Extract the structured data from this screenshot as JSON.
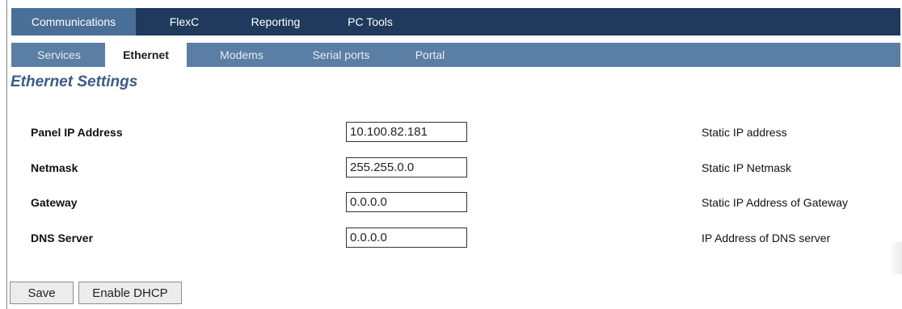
{
  "top_nav": {
    "tabs": [
      {
        "label": "Communications",
        "active": true
      },
      {
        "label": "FlexC",
        "active": false
      },
      {
        "label": "Reporting",
        "active": false
      },
      {
        "label": "PC Tools",
        "active": false
      }
    ]
  },
  "sub_nav": {
    "tabs": [
      {
        "label": "Services",
        "active": false
      },
      {
        "label": "Ethernet",
        "active": true
      },
      {
        "label": "Modems",
        "active": false
      },
      {
        "label": "Serial ports",
        "active": false
      },
      {
        "label": "Portal",
        "active": false
      }
    ]
  },
  "page": {
    "title": "Ethernet Settings"
  },
  "form": {
    "fields": [
      {
        "label": "Panel IP Address",
        "value": "10.100.82.181",
        "description": "Static IP address"
      },
      {
        "label": "Netmask",
        "value": "255.255.0.0",
        "description": "Static IP Netmask"
      },
      {
        "label": "Gateway",
        "value": "0.0.0.0",
        "description": "Static IP Address of Gateway"
      },
      {
        "label": "DNS Server",
        "value": "0.0.0.0",
        "description": "IP Address of DNS server"
      }
    ]
  },
  "actions": {
    "save_label": "Save",
    "dhcp_label": "Enable DHCP"
  },
  "colors": {
    "top_nav_bg": "#1f3a5c",
    "top_nav_active": "#4a6f96",
    "sub_nav_bg": "#5a7ea4",
    "title_color": "#3b5b86"
  }
}
